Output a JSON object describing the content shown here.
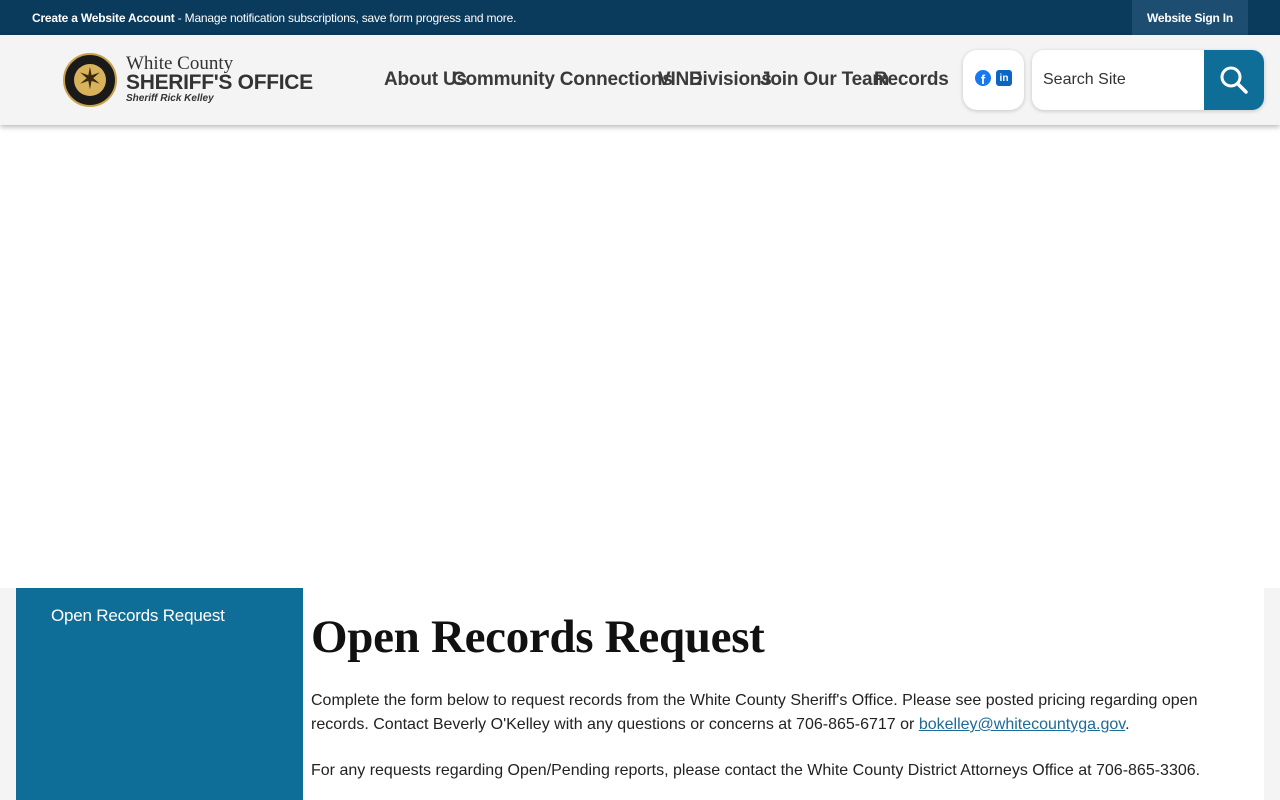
{
  "topbar": {
    "create_account": "Create a Website Account",
    "message": " - Manage notification subscriptions, save form progress and more.",
    "sign_in": "Website Sign In"
  },
  "logo": {
    "line1": "White County",
    "line2": "SHERIFF'S OFFICE",
    "line3": "Sheriff Rick Kelley",
    "badge_icon": "sheriff-star-badge"
  },
  "nav": {
    "items": [
      "About Us",
      "Community Connections",
      "VINE",
      "Divisions",
      "Join Our Team",
      "Records"
    ]
  },
  "social": {
    "facebook": "f",
    "linkedin": "in"
  },
  "search": {
    "placeholder": "Search Site",
    "icon": "search-icon"
  },
  "sidebar": {
    "items": [
      "Open Records Request"
    ]
  },
  "main": {
    "title": "Open Records Request",
    "p1_text": "Complete the form below to request records from the White County Sheriff's Office. Please see posted pricing regarding open records. Contact Beverly O'Kelley with any questions or concerns at 706-865-6717 or ",
    "p1_link": "bokelley@whitecountyga.gov",
    "p1_end": ".",
    "p2": "For any requests regarding Open/Pending reports, please contact the White County District Attorneys Office at 706-865-3306."
  },
  "colors": {
    "topbar": "#0a3a5c",
    "accent": "#0f6e98",
    "link": "#1b6b9a"
  }
}
